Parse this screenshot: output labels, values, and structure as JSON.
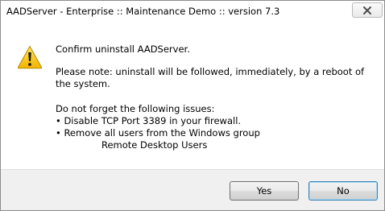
{
  "window": {
    "title": "AADServer - Enterprise :: Maintenance Demo :: version 7.3"
  },
  "dialog": {
    "icon": "warning-icon",
    "heading": "Confirm uninstall AADServer.",
    "note": "Please note: uninstall will be followed, immediately, by a reboot of the system.",
    "issues_intro": "Do not forget the following issues:",
    "issue_1": "• Disable TCP Port 3389 in your firewall.",
    "issue_2": "• Remove all users from the Windows group",
    "issue_2_group": "Remote Desktop Users"
  },
  "buttons": {
    "yes": "Yes",
    "no": "No"
  },
  "colors": {
    "warning_fill": "#f5c600",
    "default_button_border": "#3c7fb1"
  }
}
